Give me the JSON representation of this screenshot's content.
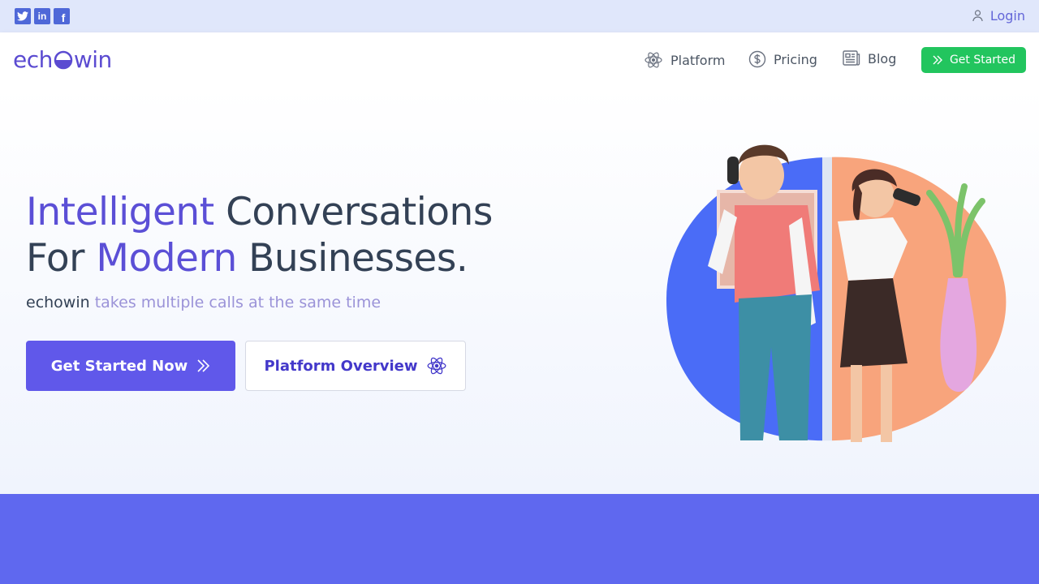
{
  "topbar": {
    "social": [
      {
        "icon": "twitter-icon",
        "label": ""
      },
      {
        "icon": "linkedin-icon",
        "label": "in"
      },
      {
        "icon": "facebook-icon",
        "label": "f"
      }
    ],
    "login_label": "Login"
  },
  "nav": {
    "logo_left": "ech",
    "logo_right": "win",
    "items": [
      {
        "label": "Platform",
        "icon": "atom-icon"
      },
      {
        "label": "Pricing",
        "icon": "dollar-icon"
      },
      {
        "label": "Blog",
        "icon": "newspaper-icon"
      }
    ],
    "cta_label": "Get Started"
  },
  "hero": {
    "line1_accent": "Intelligent",
    "line1_rest": " Conversations",
    "line2_start": "For ",
    "line2_accent": "Modern",
    "line2_rest": " Businesses.",
    "sub_brand": "echowin",
    "sub_rest": " takes multiple calls at the same time",
    "primary_button": "Get Started Now",
    "secondary_button": "Platform Overview"
  },
  "colors": {
    "accent": "#5b4fd6",
    "primary_button": "#6058ea",
    "cta_green": "#22c55e",
    "band": "#5f68ef",
    "topbar": "#e0e7fb"
  }
}
